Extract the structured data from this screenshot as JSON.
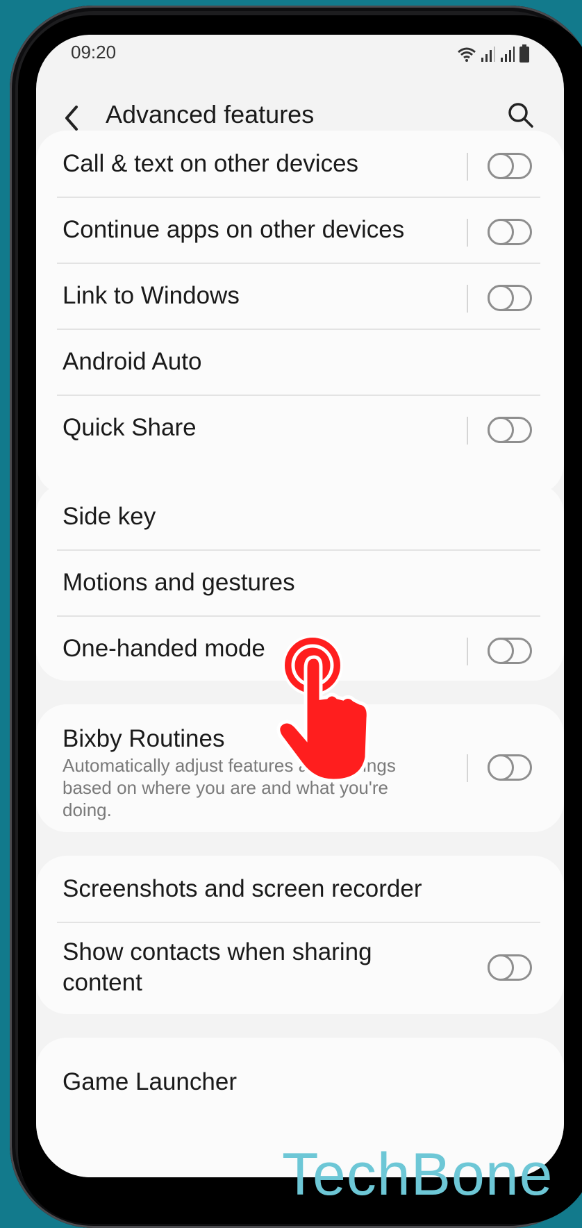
{
  "status": {
    "time": "09:20"
  },
  "header": {
    "title": "Advanced features"
  },
  "groups": [
    {
      "items": [
        {
          "label": "Call & text on other devices",
          "toggle": true
        },
        {
          "label": "Continue apps on other devices",
          "toggle": true
        },
        {
          "label": "Link to Windows",
          "toggle": true
        },
        {
          "label": "Android Auto",
          "toggle": false
        },
        {
          "label": "Quick Share",
          "toggle": true
        }
      ]
    },
    {
      "items": [
        {
          "label": "Side key",
          "toggle": false
        },
        {
          "label": "Motions and gestures",
          "toggle": false
        },
        {
          "label": "One-handed mode",
          "toggle": true
        }
      ]
    },
    {
      "items": [
        {
          "label": "Bixby Routines",
          "subtitle": "Automatically adjust features and settings based on where you are and what you're doing.",
          "toggle": true
        }
      ]
    },
    {
      "items": [
        {
          "label": "Screenshots and screen recorder",
          "toggle": false
        },
        {
          "label": "Show contacts when sharing content",
          "toggle": true
        }
      ]
    },
    {
      "items": [
        {
          "label": "Game Launcher",
          "toggle": false
        }
      ]
    }
  ],
  "watermark": "TechBone",
  "colors": {
    "accent": "#ff1e1e",
    "background": "#127a8c",
    "watermark": "#6dc7d6"
  },
  "icons": {
    "back": "chevron-left-icon",
    "search": "search-icon",
    "tap": "tap-hand-icon"
  }
}
